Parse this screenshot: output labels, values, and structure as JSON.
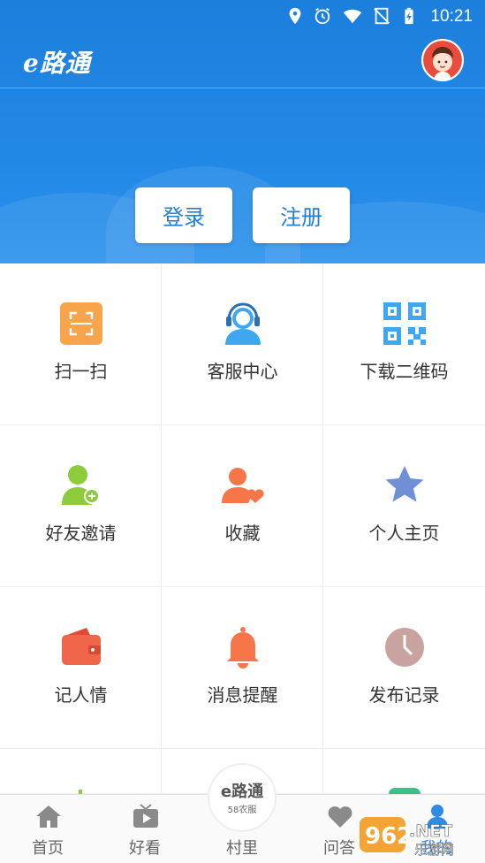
{
  "status_bar": {
    "time": "10:21"
  },
  "app_bar": {
    "logo": "e路通"
  },
  "auth": {
    "login_label": "登录",
    "register_label": "注册"
  },
  "grid": [
    {
      "label": "扫一扫",
      "icon": "scan-icon",
      "color": "#f6a54c"
    },
    {
      "label": "客服中心",
      "icon": "headset-icon",
      "color": "#3fa7f0"
    },
    {
      "label": "下载二维码",
      "icon": "qrcode-icon",
      "color": "#3fa7f0"
    },
    {
      "label": "好友邀请",
      "icon": "invite-friend-icon",
      "color": "#8ccb3c"
    },
    {
      "label": "收藏",
      "icon": "favorites-icon",
      "color": "#f6764a"
    },
    {
      "label": "个人主页",
      "icon": "star-icon",
      "color": "#6f8fd6"
    },
    {
      "label": "记人情",
      "icon": "wallet-icon",
      "color": "#f0664a"
    },
    {
      "label": "消息提醒",
      "icon": "bell-icon",
      "color": "#f6764a"
    },
    {
      "label": "发布记录",
      "icon": "clock-icon",
      "color": "#c9a3a0"
    }
  ],
  "bottom_nav": [
    {
      "label": "首页",
      "icon": "home-icon"
    },
    {
      "label": "好看",
      "icon": "video-icon"
    },
    {
      "label": "村里",
      "icon": "village-icon"
    },
    {
      "label": "问答",
      "icon": "heart-icon"
    },
    {
      "label": "我的",
      "icon": "user-icon"
    }
  ],
  "center_badge": {
    "title": "e路通",
    "subtitle": "58农服"
  },
  "watermark": {
    "text": "962.NET",
    "subtext": "乐游网"
  }
}
